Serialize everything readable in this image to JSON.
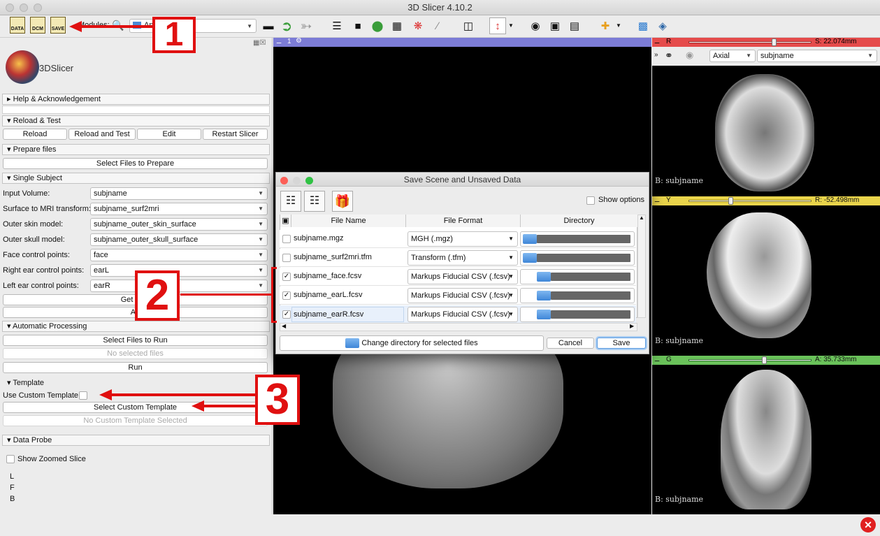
{
  "app": {
    "window_title": "3D Slicer 4.10.2",
    "logo_text": "3DSlicer"
  },
  "toolbar": {
    "data_label": "DATA",
    "dcm_label": "DCM",
    "save_label": "SAVE",
    "modules_label": "Modules:",
    "modules_value": "An"
  },
  "left": {
    "help": "Help & Acknowledgement",
    "reload_section": "Reload & Test",
    "reload_btn": "Reload",
    "reload_test_btn": "Reload and Test",
    "edit_btn": "Edit",
    "restart_btn": "Restart Slicer",
    "prepare_section": "Prepare files",
    "select_prepare_btn": "Select Files to Prepare",
    "single_section": "Single Subject",
    "fields": [
      {
        "label": "Input Volume:",
        "value": "subjname"
      },
      {
        "label": "Surface to MRI transform:",
        "value": "subjname_surf2mri"
      },
      {
        "label": "Outer skin model:",
        "value": "subjname_outer_skin_surface"
      },
      {
        "label": "Outer skull model:",
        "value": "subjname_outer_skull_surface"
      },
      {
        "label": "Face control points:",
        "value": "face"
      },
      {
        "label": "Right ear control points:",
        "value": "earL"
      },
      {
        "label": "Left ear control points:",
        "value": "earR"
      }
    ],
    "get_btn": "Get cont",
    "apply_btn": "Ap",
    "auto_section": "Automatic Processing",
    "select_run_btn": "Select Files to Run",
    "no_selected": "No selected files",
    "run_btn": "Run",
    "template_section": "Template",
    "use_custom_label": "Use Custom Template",
    "select_custom_btn": "Select Custom Template",
    "no_custom": "No Custom Template Selected",
    "probe_section": "Data Probe",
    "show_zoomed": "Show Zoomed Slice",
    "probe_l": "L",
    "probe_f": "F",
    "probe_b": "B"
  },
  "view3d": {
    "number": "1"
  },
  "slices": [
    {
      "name": "R",
      "color": "#e54b4b",
      "offset": "S: 22.074mm",
      "orientation": "Axial",
      "volume": "subjname",
      "corner": "B: subjname",
      "slider": 0.68
    },
    {
      "name": "Y",
      "color": "#e9d44b",
      "offset": "R: -52.498mm",
      "corner": "B: subjname",
      "slider": 0.32
    },
    {
      "name": "G",
      "color": "#6ac25a",
      "offset": "A: 35.733mm",
      "corner": "B: subjname",
      "slider": 0.6
    }
  ],
  "dialog": {
    "title": "Save Scene and Unsaved Data",
    "show_options": "Show options",
    "col_file": "File Name",
    "col_format": "File Format",
    "col_dir": "Directory",
    "rows": [
      {
        "file": "subjname.mgz",
        "format": "MGH (.mgz)",
        "checked": false
      },
      {
        "file": "subjname_surf2mri.tfm",
        "format": "Transform (.tfm)",
        "checked": false
      },
      {
        "file": "subjname_face.fcsv",
        "format": "Markups Fiducial CSV (.fcsv)",
        "checked": true
      },
      {
        "file": "subjname_earL.fcsv",
        "format": "Markups Fiducial CSV (.fcsv)",
        "checked": true
      },
      {
        "file": "subjname_earR.fcsv",
        "format": "Markups Fiducial CSV (.fcsv)",
        "checked": true
      }
    ],
    "change_dir_btn": "Change directory for selected files",
    "cancel_btn": "Cancel",
    "save_btn": "Save"
  },
  "annotations": {
    "one": "1",
    "two": "2",
    "three": "3"
  },
  "colors": {
    "annotation_red": "#e01010",
    "accent_blue": "#3f86d8"
  }
}
